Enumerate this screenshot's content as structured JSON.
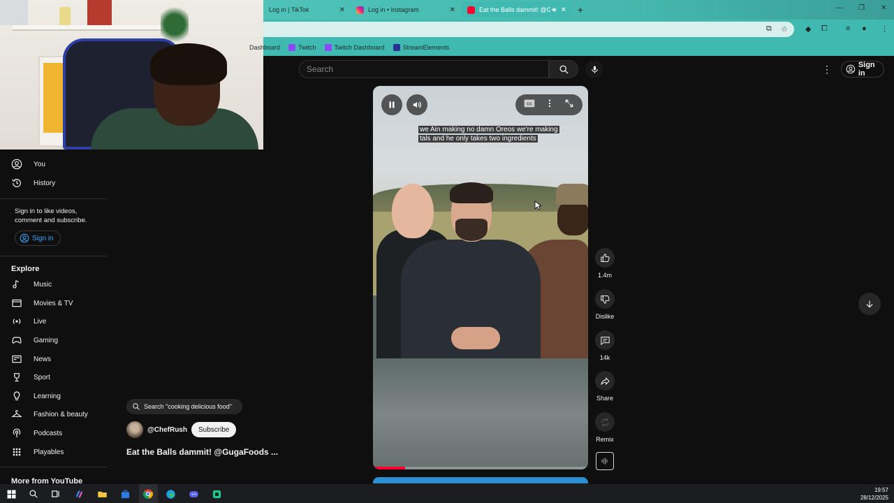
{
  "browser": {
    "tabs": [
      {
        "label": "Log in | TikTok",
        "icon": "tiktok-icon"
      },
      {
        "label": "Log in • Instagram",
        "icon": "instagram-icon"
      },
      {
        "label": "Eat the Balls dammit! @Gu",
        "icon": "youtube-icon",
        "active": true
      }
    ],
    "bookmarks": [
      {
        "label": "Dashboard"
      },
      {
        "label": "Twitch"
      },
      {
        "label": "Twitch Dashboard"
      },
      {
        "label": "StreamElements"
      }
    ],
    "colors": {
      "theme": "#40b9b0"
    }
  },
  "youtube": {
    "search": {
      "placeholder": "Search"
    },
    "header": {
      "signin_label": "Sign in"
    },
    "sidebar": {
      "you_items": [
        {
          "label": "You",
          "icon": "account-icon"
        },
        {
          "label": "History",
          "icon": "history-icon"
        }
      ],
      "signin_prompt": "Sign in to like videos, comment and subscribe.",
      "signin_label": "Sign in",
      "explore_heading": "Explore",
      "explore_items": [
        {
          "label": "Music",
          "icon": "music-icon"
        },
        {
          "label": "Movies & TV",
          "icon": "movies-icon"
        },
        {
          "label": "Live",
          "icon": "live-icon"
        },
        {
          "label": "Gaming",
          "icon": "gaming-icon"
        },
        {
          "label": "News",
          "icon": "news-icon"
        },
        {
          "label": "Sport",
          "icon": "trophy-icon"
        },
        {
          "label": "Learning",
          "icon": "learning-icon"
        },
        {
          "label": "Fashion & beauty",
          "icon": "hanger-icon"
        },
        {
          "label": "Podcasts",
          "icon": "podcast-icon"
        },
        {
          "label": "Playables",
          "icon": "playables-icon"
        }
      ],
      "more_heading": "More from YouTube"
    },
    "short": {
      "caption": "we Ain making no damn Oreos we're making tals and he only takes two ingredients",
      "progress": 0.15,
      "search_chip": "Search \"cooking delicious food\"",
      "channel": "@ChefRush",
      "subscribe_label": "Subscribe",
      "title": "Eat the Balls dammit! @GugaFoods ..."
    },
    "actions": {
      "like_count": "1.4m",
      "dislike_label": "Dislike",
      "comments_count": "14k",
      "share_label": "Share",
      "remix_label": "Remix"
    },
    "colors": {
      "accent": "#ff0033",
      "link": "#3ea6ff"
    }
  },
  "taskbar": {
    "time": "19:57",
    "date": "28/12/2025"
  }
}
